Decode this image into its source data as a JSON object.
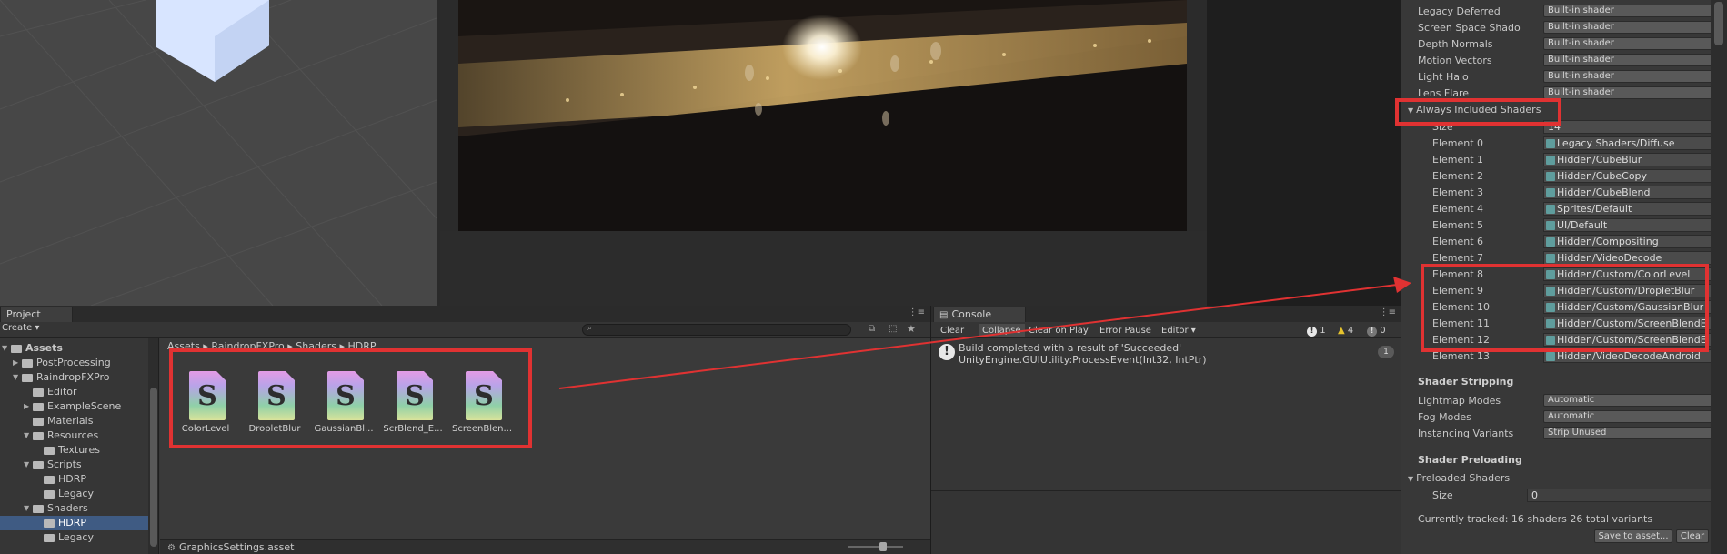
{
  "colors": {
    "highlight": "#e03232",
    "selection": "#3f5b83",
    "panel": "#383838"
  },
  "inspector": {
    "builtin_shader_rows": [
      {
        "label": "Legacy Deferred",
        "value": "Built-in shader"
      },
      {
        "label": "Screen Space Shado",
        "value": "Built-in shader"
      },
      {
        "label": "Depth Normals",
        "value": "Built-in shader"
      },
      {
        "label": "Motion Vectors",
        "value": "Built-in shader"
      },
      {
        "label": "Light Halo",
        "value": "Built-in shader"
      },
      {
        "label": "Lens Flare",
        "value": "Built-in shader"
      }
    ],
    "always_included_title": "Always Included Shaders",
    "size_label": "Size",
    "size_value": "14",
    "elements": [
      {
        "label": "Element 0",
        "value": "Legacy Shaders/Diffuse"
      },
      {
        "label": "Element 1",
        "value": "Hidden/CubeBlur"
      },
      {
        "label": "Element 2",
        "value": "Hidden/CubeCopy"
      },
      {
        "label": "Element 3",
        "value": "Hidden/CubeBlend"
      },
      {
        "label": "Element 4",
        "value": "Sprites/Default"
      },
      {
        "label": "Element 5",
        "value": "UI/Default"
      },
      {
        "label": "Element 6",
        "value": "Hidden/Compositing"
      },
      {
        "label": "Element 7",
        "value": "Hidden/VideoDecode"
      },
      {
        "label": "Element 8",
        "value": "Hidden/Custom/ColorLevel"
      },
      {
        "label": "Element 9",
        "value": "Hidden/Custom/DropletBlur"
      },
      {
        "label": "Element 10",
        "value": "Hidden/Custom/GaussianBlur"
      },
      {
        "label": "Element 11",
        "value": "Hidden/Custom/ScreenBlendE"
      },
      {
        "label": "Element 12",
        "value": "Hidden/Custom/ScreenBlendE"
      },
      {
        "label": "Element 13",
        "value": "Hidden/VideoDecodeAndroid"
      }
    ],
    "stripping_title": "Shader Stripping",
    "stripping_rows": [
      {
        "label": "Lightmap Modes",
        "value": "Automatic"
      },
      {
        "label": "Fog Modes",
        "value": "Automatic"
      },
      {
        "label": "Instancing Variants",
        "value": "Strip Unused"
      }
    ],
    "preloading_title": "Shader Preloading",
    "preloaded_title": "Preloaded Shaders",
    "preloaded_size_label": "Size",
    "preloaded_size_value": "0",
    "tracked_text": "Currently tracked: 16 shaders 26 total variants",
    "save_button": "Save to asset...",
    "clear_button": "Clear"
  },
  "project": {
    "tab_label": "Project",
    "create_label": "Create",
    "breadcrumb": "Assets ▸ RaindropFXPro ▸ Shaders ▸ HDRP",
    "tree": [
      {
        "label": "Assets",
        "depth": 0,
        "arrow": "▼",
        "bold": true
      },
      {
        "label": "PostProcessing",
        "depth": 1,
        "arrow": "▶"
      },
      {
        "label": "RaindropFXPro",
        "depth": 1,
        "arrow": "▼"
      },
      {
        "label": "Editor",
        "depth": 2,
        "arrow": ""
      },
      {
        "label": "ExampleScene",
        "depth": 2,
        "arrow": "▶"
      },
      {
        "label": "Materials",
        "depth": 2,
        "arrow": ""
      },
      {
        "label": "Resources",
        "depth": 2,
        "arrow": "▼"
      },
      {
        "label": "Textures",
        "depth": 3,
        "arrow": ""
      },
      {
        "label": "Scripts",
        "depth": 2,
        "arrow": "▼"
      },
      {
        "label": "HDRP",
        "depth": 3,
        "arrow": ""
      },
      {
        "label": "Legacy",
        "depth": 3,
        "arrow": ""
      },
      {
        "label": "Shaders",
        "depth": 2,
        "arrow": "▼"
      },
      {
        "label": "HDRP",
        "depth": 3,
        "arrow": "",
        "selected": true
      },
      {
        "label": "Legacy",
        "depth": 3,
        "arrow": ""
      }
    ],
    "assets": [
      {
        "letter": "S",
        "name": "ColorLevel"
      },
      {
        "letter": "S",
        "name": "DropletBlur"
      },
      {
        "letter": "S",
        "name": "GaussianBl..."
      },
      {
        "letter": "S",
        "name": "ScrBlend_E..."
      },
      {
        "letter": "S",
        "name": "ScreenBlen..."
      }
    ],
    "status_file": "GraphicsSettings.asset"
  },
  "console": {
    "tab_label": "Console",
    "clear": "Clear",
    "collapse": "Collapse",
    "clear_on_play": "Clear on Play",
    "error_pause": "Error Pause",
    "editor": "Editor",
    "count_info": "1",
    "count_warn": "4",
    "count_error": "0",
    "log_line1": "Build completed with a result of 'Succeeded'",
    "log_line2": "UnityEngine.GUIUtility:ProcessEvent(Int32, IntPtr)",
    "log_count": "1"
  }
}
